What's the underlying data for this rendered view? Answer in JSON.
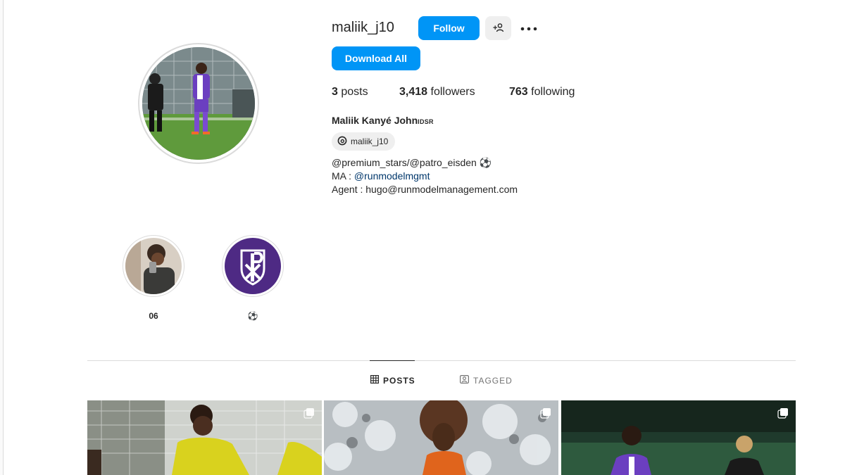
{
  "profile": {
    "username": "maliik_j10",
    "follow_label": "Follow",
    "download_label": "Download All",
    "stats": {
      "posts_count": "3",
      "posts_label": "posts",
      "followers_count": "3,418",
      "followers_label": "followers",
      "following_count": "763",
      "following_label": "following"
    },
    "full_name": "Maliik Kanyé John",
    "pronoun_badge": "IDSR",
    "threads_handle": "maliik_j10",
    "bio": {
      "line1": "@premium_stars/@patro_eisden ⚽",
      "line2_prefix": "MA : ",
      "line2_link": "@runmodelmgmt",
      "line3": "Agent : hugo@runmodelmanagement.com"
    }
  },
  "highlights": [
    {
      "label": "06"
    },
    {
      "label": "⚽"
    }
  ],
  "tabs": {
    "posts": "POSTS",
    "tagged": "TAGGED"
  },
  "colors": {
    "primary_button": "#0095f6",
    "text": "#262626",
    "secondary_text": "#737373",
    "link": "#00376b",
    "border": "#dbdbdb",
    "patro_purple": "#4e2a84"
  },
  "icons": {
    "suggest": "add-person-icon",
    "more": "more-horizontal-icon",
    "threads": "threads-icon",
    "posts_tab": "grid-icon",
    "tagged_tab": "tagged-icon",
    "carousel": "carousel-icon"
  }
}
